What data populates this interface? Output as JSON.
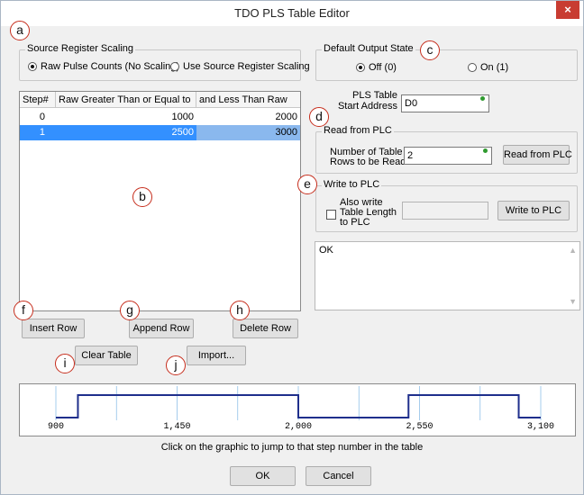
{
  "window": {
    "title": "TDO PLS Table Editor",
    "close_glyph": "×"
  },
  "source_scaling": {
    "legend": "Source Register Scaling",
    "option_raw": "Raw Pulse Counts (No Scaling)",
    "option_source": "Use Source Register Scaling",
    "selected": "raw"
  },
  "default_output": {
    "legend": "Default Output State",
    "option_off": "Off (0)",
    "option_on": "On (1)",
    "selected": "off"
  },
  "table": {
    "headers": [
      "Step#",
      "Raw Greater Than or Equal to",
      "and Less Than Raw"
    ],
    "rows": [
      {
        "step": "0",
        "ge": "1000",
        "lt": "2000"
      },
      {
        "step": "1",
        "ge": "2500",
        "lt": "3000"
      }
    ],
    "selected_index": 1
  },
  "start_address": {
    "label_line1": "PLS Table",
    "label_line2": "Start Address",
    "value": "D0"
  },
  "read_from_plc": {
    "legend": "Read from PLC",
    "label_line1": "Number of Table",
    "label_line2": "Rows to be Read",
    "value": "2",
    "button": "Read from PLC"
  },
  "write_to_plc": {
    "legend": "Write to PLC",
    "check_line1": "Also write",
    "check_line2": "Table Length",
    "check_line3": "to PLC",
    "button": "Write to PLC"
  },
  "status_text": "OK",
  "buttons": {
    "insert_row": "Insert Row",
    "append_row": "Append Row",
    "delete_row": "Delete Row",
    "clear_table": "Clear Table",
    "import": "Import...",
    "ok": "OK",
    "cancel": "Cancel"
  },
  "graph": {
    "ticks": [
      "900",
      "1,450",
      "2,000",
      "2,550",
      "3,100"
    ],
    "x_min": 900,
    "x_max": 3100,
    "high_intervals": [
      [
        1000,
        2000
      ],
      [
        2500,
        3000
      ]
    ],
    "line_color": "#1f2f8c",
    "grid_color": "#8fc0e8"
  },
  "hint": "Click on the graphic to jump to that step number in the table",
  "callouts": [
    "a",
    "b",
    "c",
    "d",
    "e",
    "f",
    "g",
    "h",
    "i",
    "j"
  ],
  "colors": {
    "callout_border": "#c62d1c",
    "selection": "#3390ff",
    "close_button": "#c83c32"
  }
}
